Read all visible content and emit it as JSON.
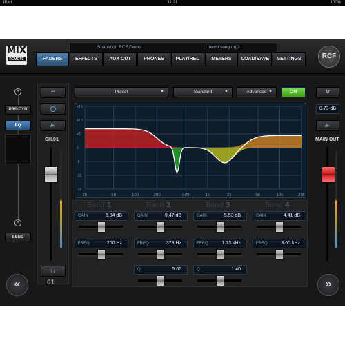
{
  "status_bar": {
    "time": "11:21",
    "left": "iPad",
    "right": "100%"
  },
  "header": {
    "logo_main": "MIX",
    "logo_sub": "REMOTE",
    "brand": "RCF",
    "snapshot": "Snapshot: RCF Demo",
    "song": "demo song.mp3"
  },
  "tabs": [
    {
      "label": "FADERS",
      "active": true
    },
    {
      "label": "EFFECTS",
      "active": false
    },
    {
      "label": "AUX OUT",
      "active": false
    },
    {
      "label": "PHONES",
      "active": false
    },
    {
      "label": "PLAY/REC",
      "active": false
    },
    {
      "label": "METERS",
      "active": false
    },
    {
      "label": "LOAD/SAVE",
      "active": false
    },
    {
      "label": "SETTINGS",
      "active": false
    }
  ],
  "left_panel": {
    "pre_dyn": "PRE-DYN",
    "eq": "EQ",
    "send": "SEND"
  },
  "channel": {
    "name": "CH.01",
    "number": "01"
  },
  "toolbar": {
    "preset": "Preset",
    "mode": "Standard",
    "view": "Advanced",
    "on": "ON"
  },
  "eq_graph": {
    "x_ticks": [
      "20",
      "50",
      "100",
      "200",
      "500",
      "1k",
      "2k",
      "5k",
      "10k",
      "20k"
    ],
    "y_ticks": [
      "+15",
      "+10",
      "+5",
      "0",
      "-5",
      "-10",
      "-15"
    ]
  },
  "bands": [
    {
      "label": "Band",
      "number": "1",
      "gain_label": "GAIN",
      "gain": "6.84 dB",
      "freq_label": "FREQ",
      "freq": "200 Hz",
      "q_label": "",
      "q": ""
    },
    {
      "label": "Band",
      "number": "2",
      "gain_label": "GAIN",
      "gain": "-9.47 dB",
      "freq_label": "FREQ",
      "freq": "378 Hz",
      "q_label": "Q",
      "q": "5.66"
    },
    {
      "label": "Band",
      "number": "3",
      "gain_label": "GAIN",
      "gain": "-5.53 dB",
      "freq_label": "FREQ",
      "freq": "1.73 kHz",
      "q_label": "Q",
      "q": "1.40"
    },
    {
      "label": "Band",
      "number": "4",
      "gain_label": "GAIN",
      "gain": "4.41 dB",
      "freq_label": "FREQ",
      "freq": "3.60 kHz",
      "q_label": "",
      "q": ""
    }
  ],
  "main_out": {
    "level": "0.73 dB",
    "label": "MAIN OUT"
  },
  "colors": {
    "accent": "#3c7bbf",
    "on_green": "#5cc02e",
    "fader_red": "#e23030"
  }
}
